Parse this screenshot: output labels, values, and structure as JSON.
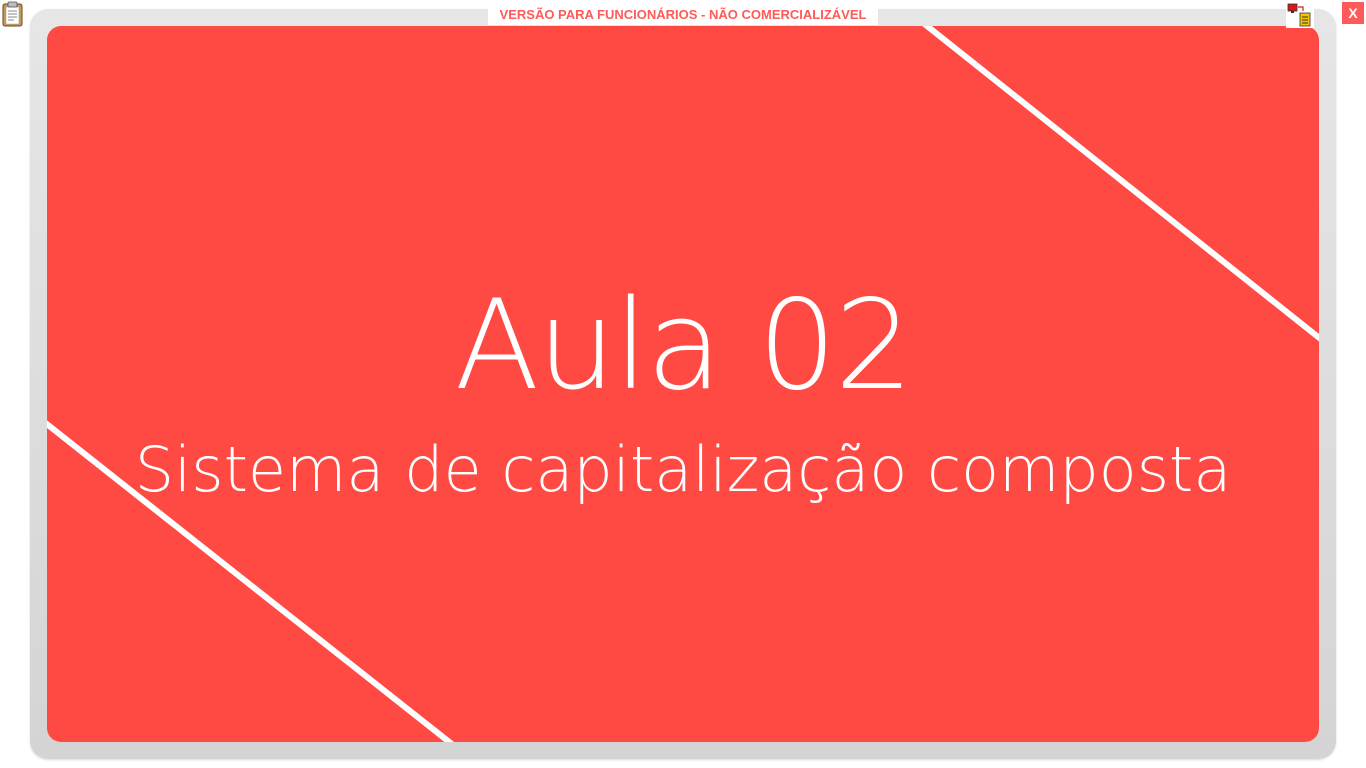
{
  "window": {
    "banner_text": "VERSÃO PARA FUNCIONÁRIOS - NÃO COMERCIALIZÁVEL",
    "close_label": "X"
  },
  "slide": {
    "title": "Aula 02",
    "subtitle": "Sistema de capitalização composta"
  },
  "icons": {
    "left": "clipboard-icon",
    "right": "network-status-icon"
  },
  "colors": {
    "slide_background": "#ff4a43",
    "stripe": "#ffffff",
    "banner_text": "#ff5a5a",
    "close_button": "#ff5a5a"
  }
}
